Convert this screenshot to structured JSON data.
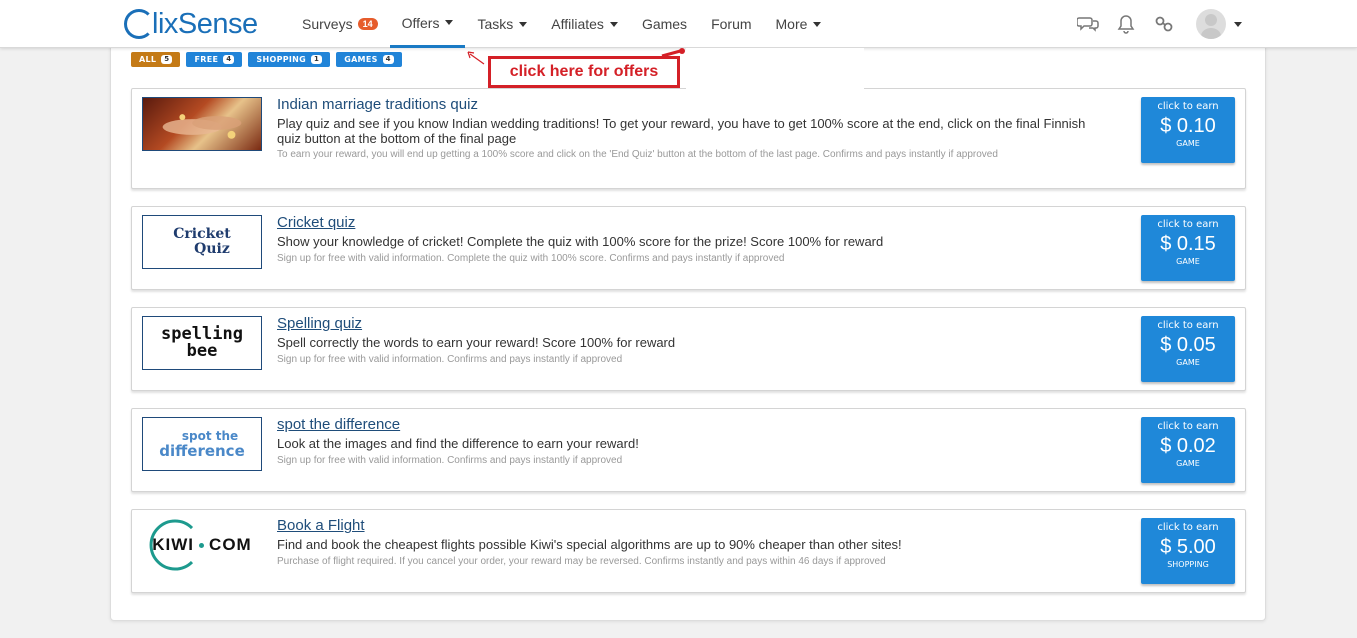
{
  "brand": {
    "logo_text": "lixSense"
  },
  "nav": {
    "surveys": "Surveys",
    "surveys_badge": "14",
    "offers": "Offers",
    "tasks": "Tasks",
    "affiliates": "Affiliates",
    "games": "Games",
    "forum": "Forum",
    "more": "More"
  },
  "filters": [
    {
      "label": "ALL",
      "count": "5"
    },
    {
      "label": "FREE",
      "count": "4"
    },
    {
      "label": "SHOPPING",
      "count": "1"
    },
    {
      "label": "GAMES",
      "count": "4"
    }
  ],
  "annotation": "click here for offers",
  "offers": [
    {
      "title": "Indian marriage traditions quiz",
      "desc": "Play quiz and see if you know Indian wedding traditions! To get your reward, you have to get 100% score at the end, click on the final Finnish quiz button at the bottom of the final page",
      "req": "To earn your reward, you will end up getting a 100% score and click on the 'End Quiz' button at the bottom of the last page. Confirms and pays instantly if approved",
      "earn_label": "click to earn",
      "amount": "$ 0.10",
      "type": "GAME"
    },
    {
      "title": "Cricket quiz",
      "thumb_text_1": "Cricket",
      "thumb_text_2": "Quiz",
      "desc": "Show your knowledge of cricket! Complete the quiz with 100% score for the prize! Score 100% for reward",
      "req": "Sign up for free with valid information. Complete the quiz with 100% score. Confirms and pays instantly if approved",
      "earn_label": "click to earn",
      "amount": "$ 0.15",
      "type": "GAME"
    },
    {
      "title": "Spelling quiz",
      "thumb_text_1": "spelling",
      "thumb_text_2": "bee",
      "desc": "Spell correctly the words to earn your reward! Score 100% for reward",
      "req": "Sign up for free with valid information. Confirms and pays instantly if approved",
      "earn_label": "click to earn",
      "amount": "$ 0.05",
      "type": "GAME"
    },
    {
      "title": "spot the difference",
      "thumb_text_1": "spot the",
      "thumb_text_2": "difference",
      "desc": "Look at the images and find the difference to earn your reward!",
      "req": "Sign up for free with valid information. Confirms and pays instantly if approved",
      "earn_label": "click to earn",
      "amount": "$ 0.02",
      "type": "GAME"
    },
    {
      "title": "Book a Flight",
      "thumb_text_1": "KIWI",
      "thumb_text_2": "COM",
      "desc": "Find and book the cheapest flights possible Kiwi's special algorithms are up to 90% cheaper than other sites!",
      "req": "Purchase of flight required. If you cancel your order, your reward may be reversed. Confirms instantly and pays within 46 days if approved",
      "earn_label": "click to earn",
      "amount": "$ 5.00",
      "type": "SHOPPING"
    }
  ],
  "colors": {
    "brand_blue": "#1a6fb8",
    "earn_blue": "#1f88d9",
    "filter_all": "#c47a16",
    "annotation_red": "#d42027"
  }
}
